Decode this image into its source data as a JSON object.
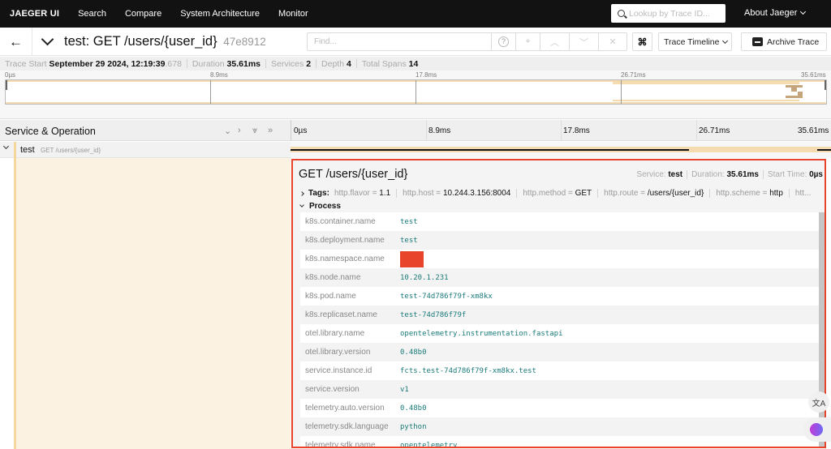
{
  "topnav": {
    "brand": "JAEGER UI",
    "items": [
      "Search",
      "Compare",
      "System Architecture",
      "Monitor"
    ],
    "lookup_placeholder": "Lookup by Trace ID...",
    "about": "About Jaeger"
  },
  "trace_header": {
    "title": "test: GET /users/{user_id}",
    "trace_id": "47e8912",
    "find_placeholder": "Find...",
    "cmd_symbol": "⌘",
    "view_mode": "Trace Timeline",
    "archive_label": "Archive Trace"
  },
  "summary": {
    "trace_start_label": "Trace Start",
    "trace_start_value": "September 29 2024, 12:19:39",
    "trace_start_ms": ".678",
    "duration_label": "Duration",
    "duration_value": "35.61ms",
    "services_label": "Services",
    "services_value": "2",
    "depth_label": "Depth",
    "depth_value": "4",
    "total_spans_label": "Total Spans",
    "total_spans_value": "14"
  },
  "minimap": {
    "ticks": [
      "0µs",
      "8.9ms",
      "17.8ms",
      "26.71ms",
      "35.61ms"
    ]
  },
  "timeline_header": {
    "title": "Service & Operation",
    "ticks": [
      "0µs",
      "8.9ms",
      "17.8ms",
      "26.71ms",
      "35.61ms"
    ]
  },
  "span": {
    "service": "test",
    "operation": "GET /users/{user_id}"
  },
  "detail": {
    "title": "GET /users/{user_id}",
    "service_label": "Service:",
    "service_value": "test",
    "duration_label": "Duration:",
    "duration_value": "35.61ms",
    "start_label": "Start Time:",
    "start_value": "0µs",
    "tags_label": "Tags:",
    "tags": [
      {
        "key": "http.flavor",
        "value": "1.1"
      },
      {
        "key": "http.host",
        "value": "10.244.3.156:8004"
      },
      {
        "key": "http.method",
        "value": "GET"
      },
      {
        "key": "http.route",
        "value": "/users/{user_id}"
      },
      {
        "key": "http.scheme",
        "value": "http"
      }
    ],
    "tags_overflow": "htt...",
    "process_label": "Process",
    "process": [
      {
        "key": "k8s.container.name",
        "value": "test"
      },
      {
        "key": "k8s.deployment.name",
        "value": "test"
      },
      {
        "key": "k8s.namespace.name",
        "value": "",
        "redacted": true
      },
      {
        "key": "k8s.node.name",
        "value": "10.20.1.231"
      },
      {
        "key": "k8s.pod.name",
        "value": "test-74d786f79f-xm8kx"
      },
      {
        "key": "k8s.replicaset.name",
        "value": "test-74d786f79f"
      },
      {
        "key": "otel.library.name",
        "value": "opentelemetry.instrumentation.fastapi"
      },
      {
        "key": "otel.library.version",
        "value": "0.48b0"
      },
      {
        "key": "service.instance.id",
        "value": "fcts.test-74d786f79f-xm8kx.test"
      },
      {
        "key": "service.version",
        "value": "v1"
      },
      {
        "key": "telemetry.auto.version",
        "value": "0.48b0"
      },
      {
        "key": "telemetry.sdk.language",
        "value": "python"
      },
      {
        "key": "telemetry.sdk.name",
        "value": "opentelemetry"
      }
    ]
  },
  "widgets": {
    "translate_icon": "translate-icon",
    "assistant_icon": "brain-icon"
  }
}
